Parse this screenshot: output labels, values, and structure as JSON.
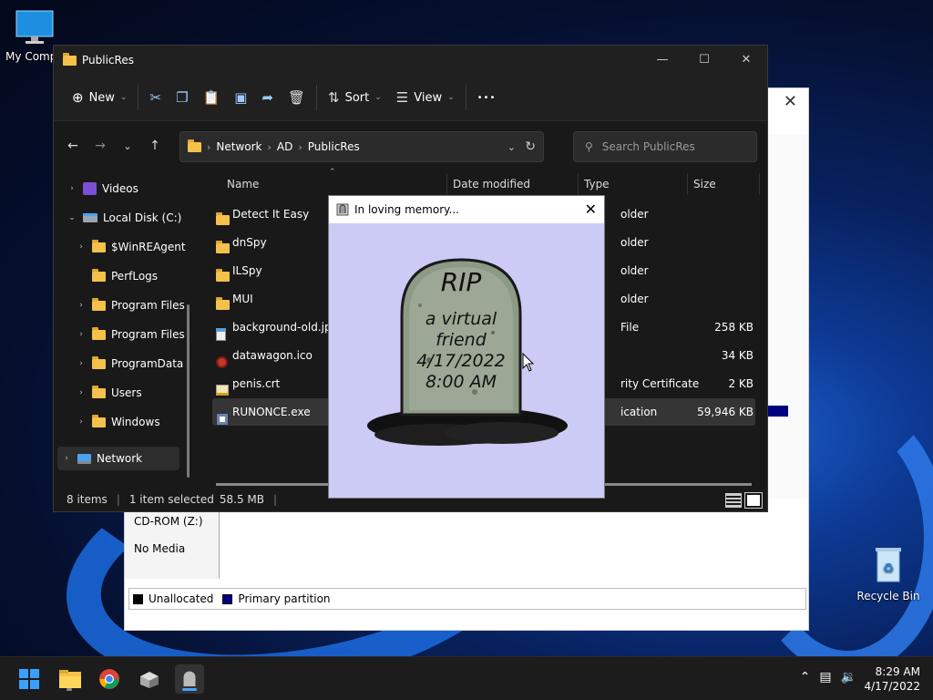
{
  "desktop": {
    "icons": [
      {
        "label": "My Compu",
        "icon": "monitor-icon"
      },
      {
        "label": "Recycle Bin",
        "icon": "recycle-bin-icon"
      }
    ]
  },
  "disk_manager": {
    "panel_lines": [
      "CD-ROM (Z:)",
      "No Media"
    ],
    "legend": [
      {
        "label": "Unallocated",
        "color": "#000000"
      },
      {
        "label": "Primary partition",
        "color": "#000080"
      }
    ]
  },
  "explorer": {
    "title": "PublicRes",
    "toolbar": {
      "new_label": "New",
      "sort_label": "Sort",
      "view_label": "View",
      "more_label": "•••"
    },
    "breadcrumb": [
      "Network",
      "AD",
      "PublicRes"
    ],
    "search_placeholder": "Search PublicRes",
    "nav": [
      {
        "label": "Videos",
        "level": 1,
        "expander": "›"
      },
      {
        "label": "Local Disk (C:)",
        "level": 1,
        "expander": "⌄"
      },
      {
        "label": "$WinREAgent",
        "level": 2,
        "expander": "›"
      },
      {
        "label": "PerfLogs",
        "level": 2,
        "expander": ""
      },
      {
        "label": "Program Files",
        "level": 2,
        "expander": "›"
      },
      {
        "label": "Program Files",
        "level": 2,
        "expander": "›"
      },
      {
        "label": "ProgramData",
        "level": 2,
        "expander": "›"
      },
      {
        "label": "Users",
        "level": 2,
        "expander": "›"
      },
      {
        "label": "Windows",
        "level": 2,
        "expander": "›"
      },
      {
        "label": "Network",
        "level": 0,
        "expander": "›"
      }
    ],
    "columns": {
      "name": "Name",
      "date": "Date modified",
      "type": "Type",
      "size": "Size"
    },
    "files": [
      {
        "name": "Detect It Easy",
        "type": "older",
        "size": "",
        "icon": "folder-icon"
      },
      {
        "name": "dnSpy",
        "type": "older",
        "size": "",
        "icon": "folder-icon"
      },
      {
        "name": "ILSpy",
        "type": "older",
        "size": "",
        "icon": "folder-icon"
      },
      {
        "name": "MUI",
        "type": "older",
        "size": "",
        "icon": "folder-icon"
      },
      {
        "name": "background-old.jpg",
        "type": "File",
        "size": "258 KB",
        "icon": "image-file-icon"
      },
      {
        "name": "datawagon.ico",
        "type": "",
        "size": "34 KB",
        "icon": "ico-file-icon"
      },
      {
        "name": "penis.crt",
        "type": "rity Certificate",
        "size": "2 KB",
        "icon": "certificate-icon"
      },
      {
        "name": "RUNONCE.exe",
        "type": "ication",
        "size": "59,946 KB",
        "icon": "exe-icon"
      }
    ],
    "status": {
      "items": "8 items",
      "selected": "1 item selected",
      "size": "58.5 MB"
    }
  },
  "popup": {
    "title": "In loving memory...",
    "lines": [
      "RIP",
      "a virtual",
      "friend",
      "4/17/2022",
      "8:00 AM"
    ]
  },
  "taskbar": {
    "time": "8:29 AM",
    "date": "4/17/2022"
  }
}
